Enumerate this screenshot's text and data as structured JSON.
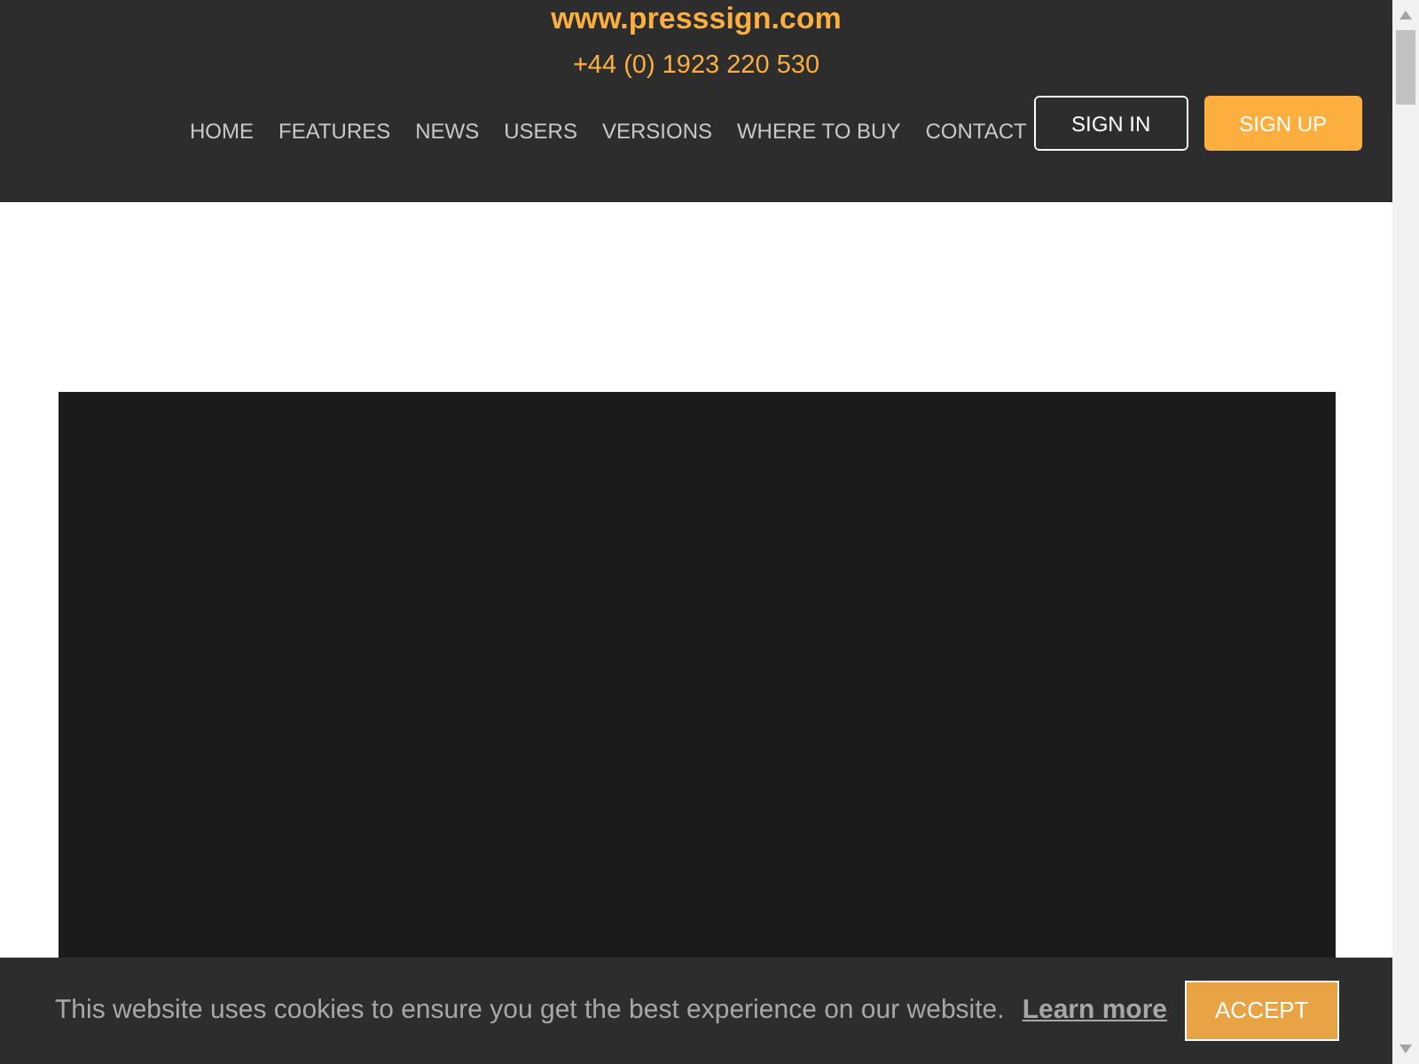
{
  "header": {
    "site_url": "www.presssign.com",
    "phone": "+44 (0) 1923 220 530",
    "nav": [
      {
        "label": "HOME"
      },
      {
        "label": "FEATURES"
      },
      {
        "label": "NEWS"
      },
      {
        "label": "USERS"
      },
      {
        "label": "VERSIONS"
      },
      {
        "label": "WHERE TO BUY"
      },
      {
        "label": "CONTACT"
      }
    ],
    "buttons": [
      {
        "label": "SIGN IN",
        "kind": "outline"
      },
      {
        "label": "SIGN UP",
        "kind": "filled"
      }
    ]
  },
  "main": {
    "video": {
      "kind": "video"
    }
  },
  "cookie_bar": {
    "message": "This website uses cookies to ensure you get the best experience on our website.",
    "link": "Learn more",
    "button": "ACCEPT"
  }
}
